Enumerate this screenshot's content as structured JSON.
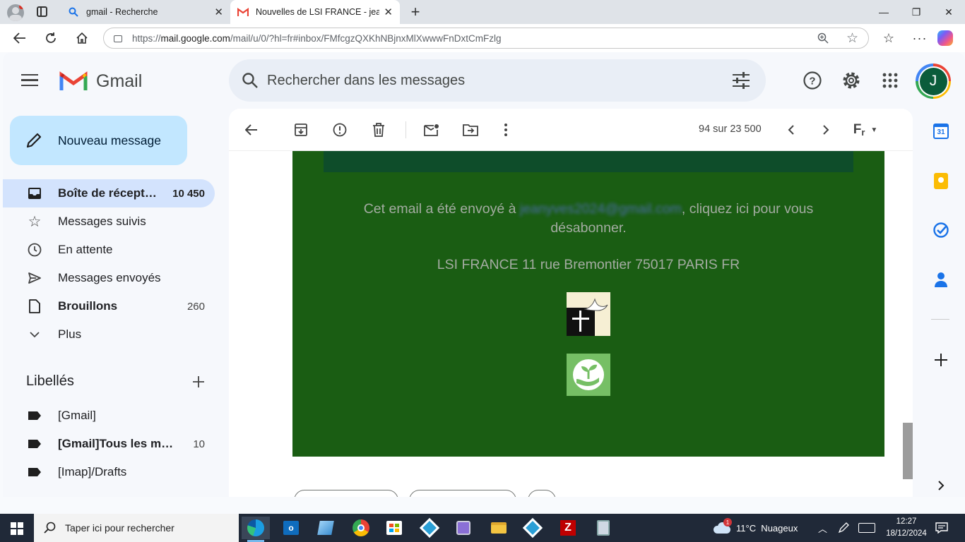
{
  "browser": {
    "tabs": [
      {
        "title": "gmail - Recherche"
      },
      {
        "title": "Nouvelles de LSI FRANCE - jeanyv"
      }
    ],
    "url_prefix": "https://",
    "url_host": "mail.google.com",
    "url_path": "/mail/u/0/?hl=fr#inbox/FMfcgzQXKhNBjnxMlXwwwFnDxtCmFzlg"
  },
  "gmail": {
    "logo_text": "Gmail",
    "avatar_letter": "J",
    "search_placeholder": "Rechercher dans les messages",
    "compose_label": "Nouveau message",
    "nav": [
      {
        "label": "Boîte de réception",
        "count": "10 450"
      },
      {
        "label": "Messages suivis",
        "count": ""
      },
      {
        "label": "En attente",
        "count": ""
      },
      {
        "label": "Messages envoyés",
        "count": ""
      },
      {
        "label": "Brouillons",
        "count": "260"
      },
      {
        "label": "Plus",
        "count": ""
      }
    ],
    "labels_title": "Libellés",
    "labels": [
      {
        "label": "[Gmail]",
        "count": ""
      },
      {
        "label": "[Gmail]Tous les messages",
        "count": "10"
      },
      {
        "label": "[Imap]/Drafts",
        "count": ""
      }
    ],
    "pager": "94 sur 23 500",
    "calendar_day": "31"
  },
  "email": {
    "sent_prefix": "Cet email a été envoyé à ",
    "sent_email": "jeanyves2024@gmail.com",
    "sent_suffix": ", cliquez ici pour vous",
    "sent_line2": "désabonner.",
    "address": "LSI FRANCE 11 rue Bremontier 75017 PARIS FR"
  },
  "taskbar": {
    "search_placeholder": "Taper ici pour rechercher",
    "weather": "11°C  Nuageux",
    "weather_badge": "1",
    "time": "12:27",
    "date": "18/12/2024"
  }
}
